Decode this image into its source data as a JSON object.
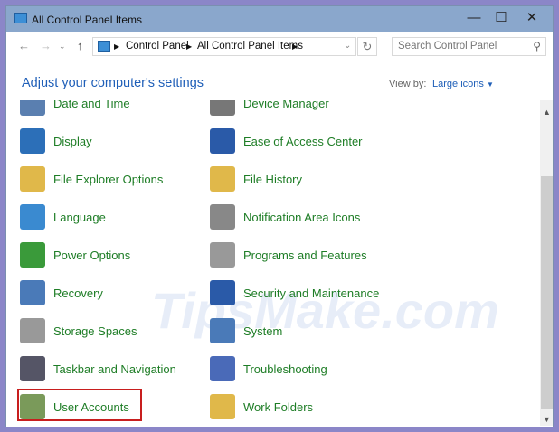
{
  "window": {
    "title": "All Control Panel Items"
  },
  "address": {
    "crumbs": [
      "Control Panel",
      "All Control Panel Items"
    ]
  },
  "search": {
    "placeholder": "Search Control Panel"
  },
  "header": {
    "title": "Adjust your computer's settings",
    "view_by_label": "View by:",
    "view_by_value": "Large icons"
  },
  "watermark": "TipsMake.com",
  "items": [
    {
      "label": "Date and Time",
      "color": "#5a7fb0"
    },
    {
      "label": "Device Manager",
      "color": "#777"
    },
    {
      "label": "Display",
      "color": "#2c6fb8"
    },
    {
      "label": "Ease of Access Center",
      "color": "#2a5aa8"
    },
    {
      "label": "File Explorer Options",
      "color": "#e0b84a"
    },
    {
      "label": "File History",
      "color": "#e0b84a"
    },
    {
      "label": "Language",
      "color": "#3a8ad0"
    },
    {
      "label": "Notification Area Icons",
      "color": "#888"
    },
    {
      "label": "Power Options",
      "color": "#3a9a3a"
    },
    {
      "label": "Programs and Features",
      "color": "#999"
    },
    {
      "label": "Recovery",
      "color": "#4a7ab8"
    },
    {
      "label": "Security and Maintenance",
      "color": "#2a5aa8"
    },
    {
      "label": "Storage Spaces",
      "color": "#999"
    },
    {
      "label": "System",
      "color": "#4a7ab8"
    },
    {
      "label": "Taskbar and Navigation",
      "color": "#556"
    },
    {
      "label": "Troubleshooting",
      "color": "#4a6ab8"
    },
    {
      "label": "User Accounts",
      "color": "#7a9a5a"
    },
    {
      "label": "Work Folders",
      "color": "#e0b84a"
    }
  ]
}
